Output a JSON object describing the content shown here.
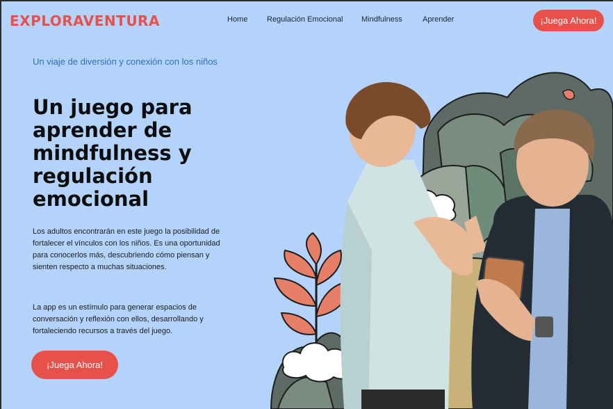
{
  "brand": {
    "logo": "EXPLORAVENTURA"
  },
  "nav": {
    "items": [
      "Home",
      "Regulación Emocional",
      "Mindfulness",
      "Aprender"
    ],
    "cta": "¡Juega Ahora!"
  },
  "hero": {
    "tagline": "Un viaje de diversión y conexión con los niños",
    "title": "Un juego para aprender de mindfulness y regulación emocional",
    "paragraph1": "Los adultos encontrarán en este juego la posibilidad de fortalecer el vínculos con los niños. Es una oportunidad para conocerlos más, descubriendo cómo piensan y sienten respecto a muchas situaciones.",
    "paragraph2": "La app es un estímulo para generar espacios de conversación y reflexión con ellos, desarrollando y fortaleciendo recursos a través del juego.",
    "cta": "¡Juega Ahora!"
  },
  "colors": {
    "background": "#b3d3fb",
    "accent": "#e8504a",
    "tagline": "#2f6fb9"
  },
  "image": {
    "subject": "boy-and-father-high-five-illustration"
  }
}
